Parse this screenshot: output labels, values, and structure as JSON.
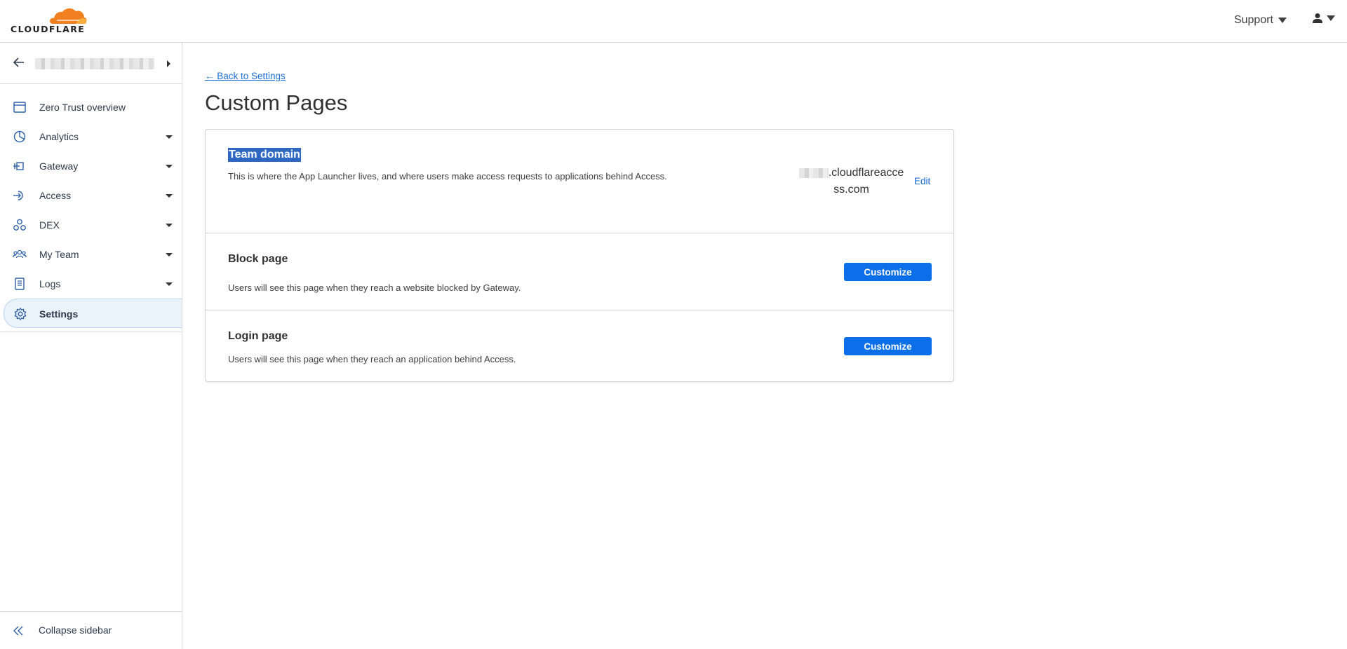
{
  "header": {
    "logo_text": "CLOUDFLARE",
    "support_label": "Support",
    "brand_orange": "#f38020"
  },
  "sidebar": {
    "account_name": "",
    "items": [
      {
        "label": "Zero Trust overview",
        "icon": "browser-window-icon",
        "expandable": false
      },
      {
        "label": "Analytics",
        "icon": "pie-chart-icon",
        "expandable": true
      },
      {
        "label": "Gateway",
        "icon": "gateway-icon",
        "expandable": true
      },
      {
        "label": "Access",
        "icon": "access-icon",
        "expandable": true
      },
      {
        "label": "DEX",
        "icon": "dex-icon",
        "expandable": true
      },
      {
        "label": "My Team",
        "icon": "team-icon",
        "expandable": true
      },
      {
        "label": "Logs",
        "icon": "logs-icon",
        "expandable": true
      },
      {
        "label": "Settings",
        "icon": "gear-icon",
        "expandable": false,
        "active": true
      }
    ],
    "collapse_label": "Collapse sidebar"
  },
  "main": {
    "back_link": "← Back to Settings",
    "title": "Custom Pages",
    "sections": [
      {
        "title": "Team domain",
        "description": "This is where the App Launcher lives, and where users make access requests to applications behind Access.",
        "domain_line1": ".cloudflareacce",
        "domain_line2": "ss.com",
        "edit_label": "Edit"
      },
      {
        "title": "Block page",
        "description": "Users will see this page when they reach a website blocked by Gateway.",
        "button_label": "Customize"
      },
      {
        "title": "Login page",
        "description": "Users will see this page when they reach an application behind Access.",
        "button_label": "Customize"
      }
    ]
  },
  "colors": {
    "accent": "#0a6fe8",
    "link": "#1a6ed8",
    "selection": "#2f67c5"
  }
}
